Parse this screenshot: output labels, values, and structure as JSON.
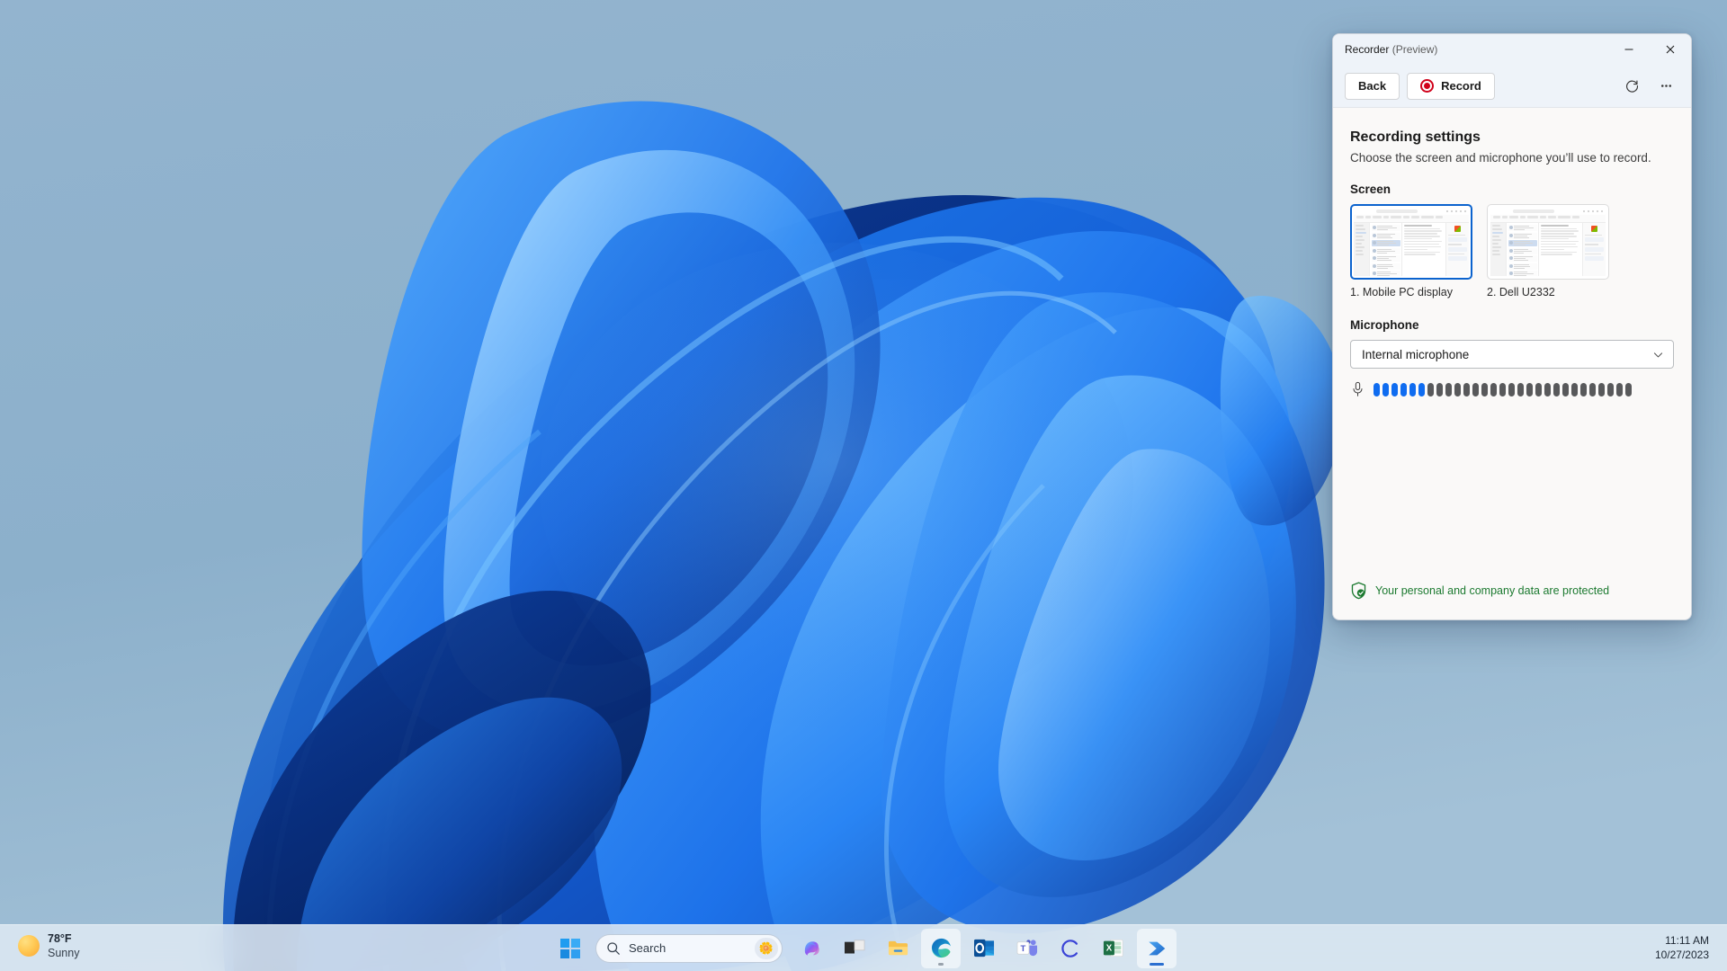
{
  "desktop": {
    "wallpaper_name": "windows-bloom-wallpaper",
    "background_color": "#8cb0cb"
  },
  "taskbar": {
    "weather": {
      "temperature": "78°F",
      "condition": "Sunny",
      "icon": "sun-icon"
    },
    "start_button_label": "Start",
    "search": {
      "placeholder": "Search",
      "value": "",
      "icon": "search-icon",
      "avatar_icon": "lotus-flower-icon"
    },
    "apps": [
      {
        "name": "copilot",
        "label": "Copilot",
        "active": false
      },
      {
        "name": "task-view",
        "label": "Task View",
        "active": false
      },
      {
        "name": "file-explorer",
        "label": "File Explorer",
        "active": false
      },
      {
        "name": "microsoft-edge",
        "label": "Microsoft Edge",
        "active": true
      },
      {
        "name": "outlook",
        "label": "Outlook",
        "active": false
      },
      {
        "name": "microsoft-teams",
        "label": "Microsoft Teams",
        "active": false
      },
      {
        "name": "copilot-consumer",
        "label": "C",
        "active": false
      },
      {
        "name": "excel",
        "label": "Excel",
        "active": false
      },
      {
        "name": "power-automate",
        "label": "Power Automate",
        "active": true
      }
    ],
    "clock": {
      "time": "11:11 AM",
      "date": "10/27/2023"
    }
  },
  "recorder_window": {
    "title_main": "Recorder",
    "title_suffix": " (Preview)",
    "titlebar_buttons": {
      "minimize": "—",
      "close": "✕"
    },
    "toolbar": {
      "back_label": "Back",
      "record_label": "Record",
      "refresh_icon": "refresh-icon",
      "more_icon": "more-options-icon"
    },
    "body": {
      "heading": "Recording settings",
      "subtitle": "Choose the screen and microphone you’ll use to record.",
      "screen_section_label": "Screen",
      "screens": [
        {
          "caption": "1. Mobile PC display",
          "selected": true
        },
        {
          "caption": "2. Dell U2332",
          "selected": false
        }
      ],
      "microphone_section_label": "Microphone",
      "microphone_selected": "Internal microphone",
      "microphone_icon": "microphone-icon",
      "dropdown_icon": "chevron-down-icon",
      "level_meter": {
        "total_bars": 29,
        "active_bars": 6,
        "active_color": "#0f6cf0",
        "inactive_color": "#58595b"
      }
    },
    "footer": {
      "icon": "shield-check-icon",
      "text": "Your personal and company data are protected",
      "color": "#1c7a30"
    }
  }
}
